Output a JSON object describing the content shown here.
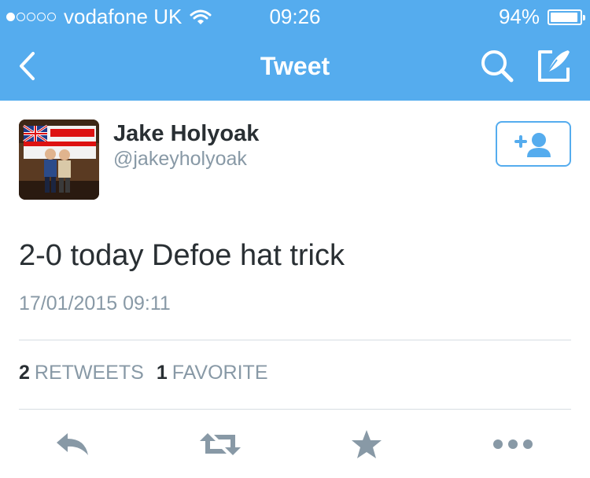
{
  "status_bar": {
    "carrier": "vodafone UK",
    "time": "09:26",
    "battery_percent": "94%",
    "battery_level": 0.94,
    "signal_bars": 1,
    "signal_total": 5
  },
  "nav": {
    "title": "Tweet",
    "back_icon": "chevron-left-icon",
    "search_icon": "search-icon",
    "compose_icon": "compose-icon"
  },
  "tweet": {
    "author_name": "Jake Holyoak",
    "author_handle": "@jakeyholyoak",
    "text": "2-0 today Defoe hat trick",
    "timestamp": "17/01/2015 09:11",
    "retweet_count": "2",
    "retweet_label": "RETWEETS",
    "favorite_count": "1",
    "favorite_label": "FAVORITE"
  },
  "actions": [
    "reply-icon",
    "retweet-icon",
    "favorite-icon",
    "more-icon"
  ],
  "colors": {
    "accent": "#55acee",
    "text_primary": "#292f33",
    "text_secondary": "#8899a6",
    "action_icon": "#8899a6"
  }
}
